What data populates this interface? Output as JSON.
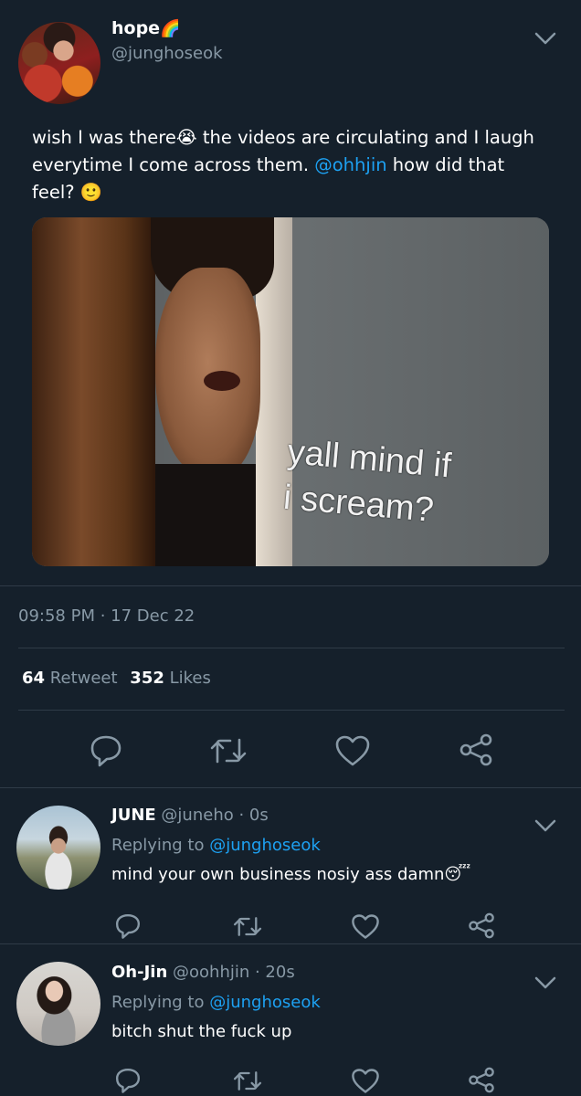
{
  "main_tweet": {
    "name": "hope",
    "name_emoji": "🌈",
    "handle": "@junghoseok",
    "text_part1": "wish I was there",
    "emoji_crying": "😭",
    "text_part2": " the videos are circulating and I laugh everytime I come across them. ",
    "mention": "@ohhjin",
    "text_part3": " how did that feel? ",
    "emoji_smile": "🙂",
    "image_caption_line1": "yall mind if",
    "image_caption_line2": "i scream?",
    "time": "09:58 PM · 17 Dec 22",
    "retweet_count": "64",
    "retweet_label": "Retweet",
    "like_count": "352",
    "like_label": "Likes"
  },
  "replies": [
    {
      "name": "JUNE",
      "handle_time": "@juneho · 0s",
      "replying_prefix": "Replying to ",
      "replying_to": "@junghoseok",
      "text": "mind your own business nosiy ass damn",
      "emoji": "😴"
    },
    {
      "name": "Oh-Jin",
      "handle_time": "@oohhjin · 20s",
      "replying_prefix": "Replying to ",
      "replying_to": "@junghoseok",
      "text": "bitch shut the fuck up",
      "emoji": ""
    }
  ],
  "colors": {
    "background": "#15202b",
    "muted": "#8899a6",
    "link": "#1da1f2",
    "divider": "#2f3b47"
  },
  "icons": [
    "chevron-down-icon",
    "reply-icon",
    "retweet-icon",
    "like-icon",
    "share-icon"
  ]
}
